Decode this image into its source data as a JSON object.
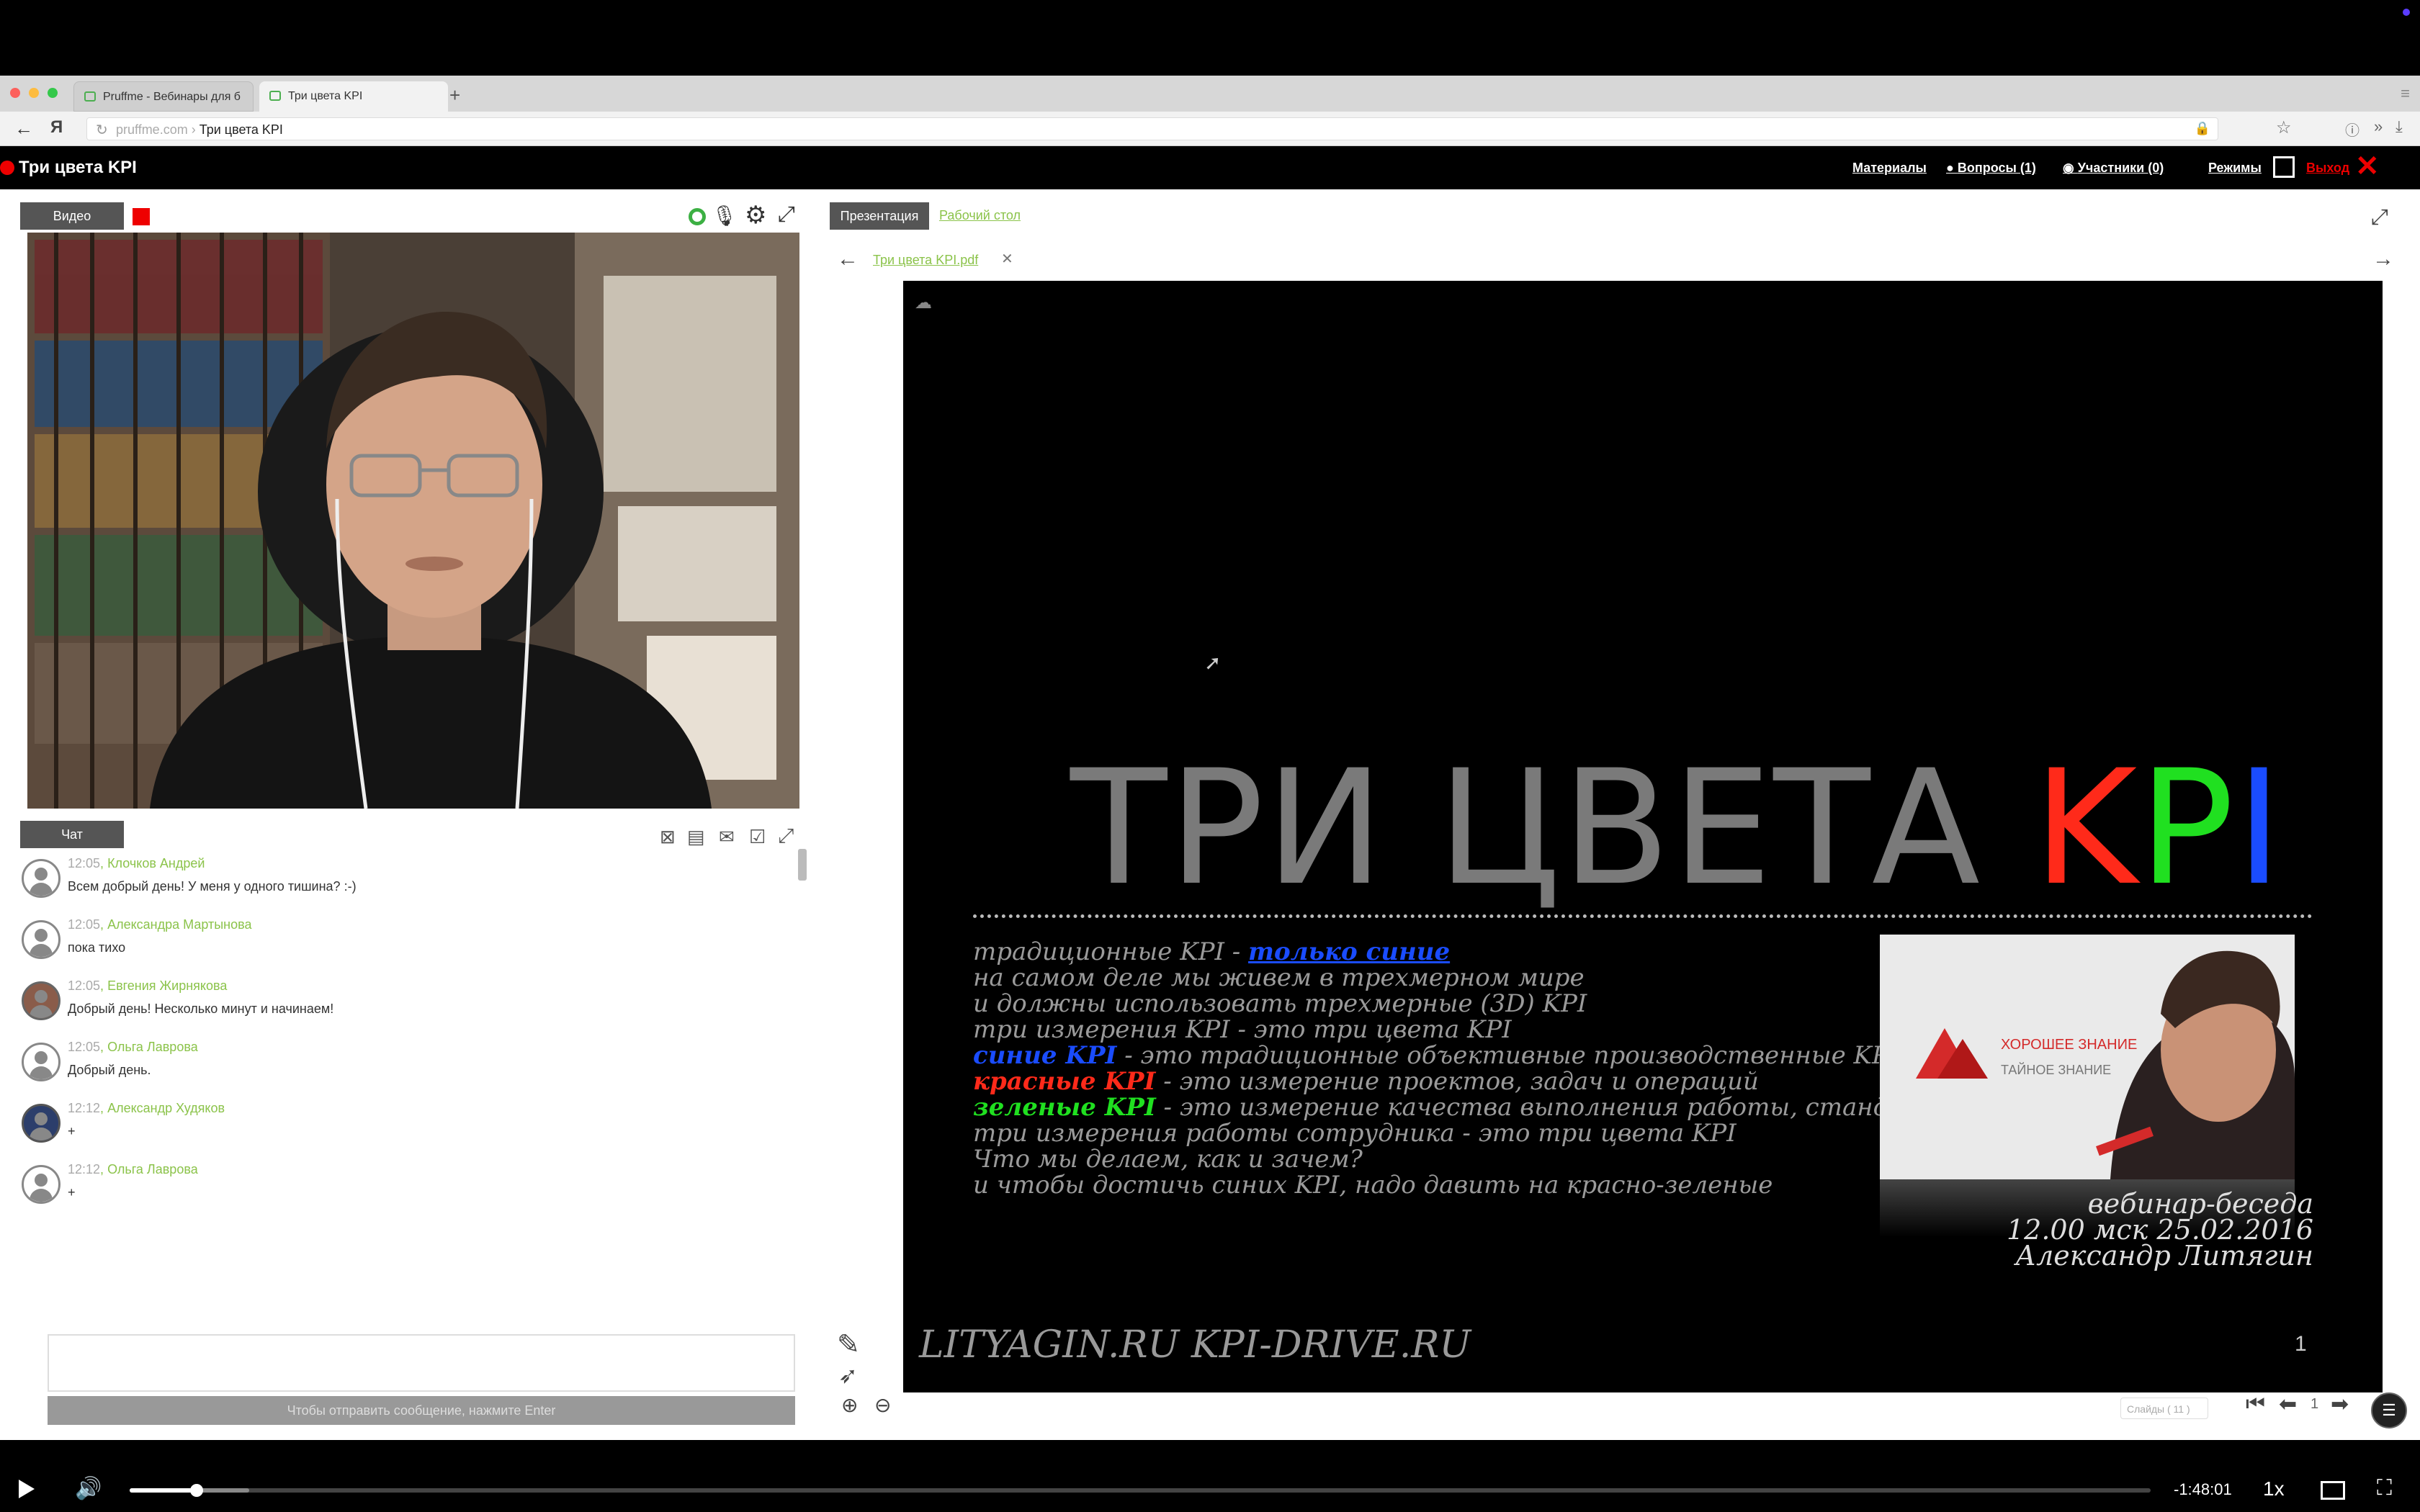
{
  "browser": {
    "tabs": [
      {
        "label": "Pruffme - Вебинары для б"
      },
      {
        "label": "Три цвета KPI"
      }
    ],
    "url_host": "pruffme.com",
    "url_title": "Три цвета KPI"
  },
  "app": {
    "title": "Три цвета KPI",
    "nav": {
      "materials": "Материалы",
      "questions": "Вопросы (1)",
      "participants": "Участники (0)",
      "modes": "Режимы",
      "exit": "Выход"
    }
  },
  "video_panel": {
    "tab": "Видео"
  },
  "chat": {
    "tab": "Чат",
    "messages": [
      {
        "time": "12:05",
        "author": "Клочков Андрей",
        "text": "Всем добрый день! У меня у одного тишина? :-)"
      },
      {
        "time": "12:05",
        "author": "Александра Мартынова",
        "text": "пока тихо"
      },
      {
        "time": "12:05",
        "author": "Евгения Жирнякова",
        "text": "Добрый день! Несколько минут и начинаем!"
      },
      {
        "time": "12:05",
        "author": "Ольга Лаврова",
        "text": "Добрый день."
      },
      {
        "time": "12:12",
        "author": "Александр Худяков",
        "text": "+"
      },
      {
        "time": "12:12",
        "author": "Ольга Лаврова",
        "text": "+"
      }
    ],
    "send_hint": "Чтобы отправить сообщение, нажмите Enter"
  },
  "presentation": {
    "tabs": {
      "active": "Презентация",
      "inactive": "Рабочий стол"
    },
    "file_name": "Три цвета KPI.pdf",
    "slides_label": "Слайды ( 11 )",
    "current_page": "1"
  },
  "slide": {
    "title_gray": "ТРИ ЦВЕТА",
    "title_k": "K",
    "title_p": "P",
    "title_i": "I",
    "line1_a": "традиционные KPI - ",
    "line1_b": "только синие",
    "line2": "на самом деле мы живем в трехмерном мире",
    "line3": "и должны использовать трехмерные (3D) KPI",
    "line4": "три измерения KPI - это три цвета KPI",
    "line5_a": "синие KPI",
    "line5_b": " - это традиционные объективные производственные  KPI",
    "line6_a": "красные KPI",
    "line6_b": " - это измерение проектов, задач и операций",
    "line7_a": "зеленые KPI",
    "line7_b": " - это измерение качества выполнения работы, стандарты",
    "line8": "три измерения работы сотрудника - это три цвета KPI",
    "line9": "Что мы делаем, как и зачем?",
    "line10": "и чтобы достичь синих KPI, надо давить на красно-зеленые",
    "book_title1": "ХОРОШЕЕ ЗНАНИЕ",
    "book_title2": "ТАЙНОЕ ЗНАНИЕ",
    "event1": "вебинар-беседа",
    "event2": "12.00 мск  25.02.2016",
    "event3": "Александр Литягин",
    "footer": "LITYAGIN.RU  KPI-DRIVE.RU",
    "page_num": "1",
    "colors": {
      "red": "#ff2a1a",
      "green": "#20e020",
      "blue": "#1a4cff",
      "gray": "#7a7a7a"
    }
  },
  "player": {
    "time_remaining": "-1:48:01",
    "speed": "1x",
    "progress": 0.033,
    "buffered": 0.059
  }
}
